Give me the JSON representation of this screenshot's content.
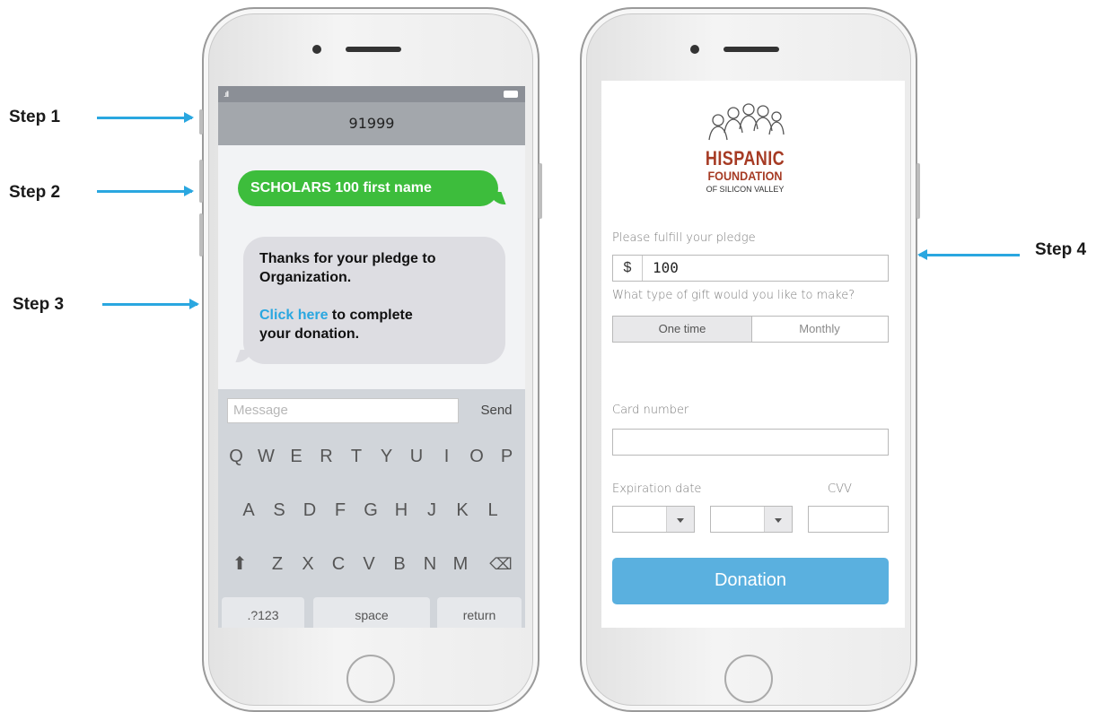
{
  "steps": [
    "Step 1",
    "Step 2",
    "Step 3",
    "Step 4"
  ],
  "colors": {
    "arrow": "#2aa7e0",
    "outgoing_bubble": "#3dbd3c",
    "link": "#2aa7e0",
    "donate_button": "#5ab0df",
    "logo": "#a63b24"
  },
  "sms": {
    "contact": "91999",
    "outgoing_message": "SCHOLARS 100 first name",
    "incoming_line1": "Thanks for your pledge to",
    "incoming_line2": "Organization.",
    "link_text": "Click here",
    "incoming_line3_rest": " to complete",
    "incoming_line4": "your donation.",
    "message_placeholder": "Message",
    "send_label": "Send",
    "keyboard_row1": [
      "Q",
      "W",
      "E",
      "R",
      "T",
      "Y",
      "U",
      "I",
      "O",
      "P"
    ],
    "keyboard_row2": [
      "A",
      "S",
      "D",
      "F",
      "G",
      "H",
      "J",
      "K",
      "L"
    ],
    "keyboard_row3": [
      "Z",
      "X",
      "C",
      "V",
      "B",
      "N",
      "M"
    ],
    "key_numbers": ".?123",
    "key_space": "space",
    "key_return": "return"
  },
  "donation": {
    "logo_line1": "HISPANIC",
    "logo_line2": "FOUNDATION",
    "logo_line3": "OF SILICON VALLEY",
    "pledge_label": "Please fulfill your pledge",
    "currency_symbol": "$",
    "pledge_amount": "100",
    "gift_type_label": "What type of gift would you like to make?",
    "gift_options": [
      "One time",
      "Monthly"
    ],
    "selected_gift": "One time",
    "card_label": "Card number",
    "card_value": "",
    "expiration_label": "Expiration date",
    "cvv_label": "CVV",
    "donate_button": "Donation"
  }
}
